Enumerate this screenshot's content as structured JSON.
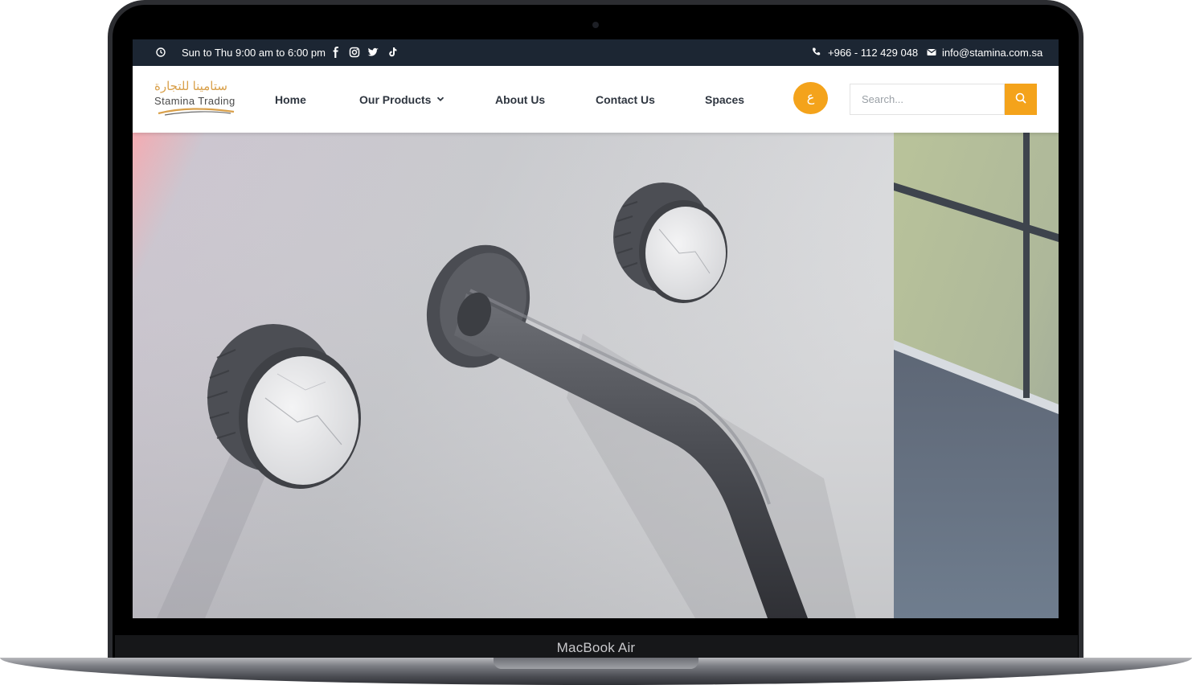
{
  "device": {
    "label": "MacBook Air"
  },
  "topbar": {
    "hours": "Sun to Thu 9:00 am to 6:00 pm",
    "phone": "+966 - 112 429 048",
    "email": "info@stamina.com.sa",
    "icons": [
      "clock-icon",
      "facebook-icon",
      "instagram-icon",
      "twitter-icon",
      "tiktok-icon",
      "phone-icon",
      "mail-icon"
    ]
  },
  "logo": {
    "arabic": "ستامينا للتجارة",
    "english": "Stamina Trading"
  },
  "nav": {
    "home": "Home",
    "products": "Our Products",
    "about": "About Us",
    "contact": "Contact Us",
    "spaces": "Spaces"
  },
  "lang_toggle": "ع",
  "search": {
    "placeholder": "Search..."
  },
  "colors": {
    "accent": "#f4a31b",
    "topbar": "#1c2633",
    "nav_text": "#2f3640"
  }
}
